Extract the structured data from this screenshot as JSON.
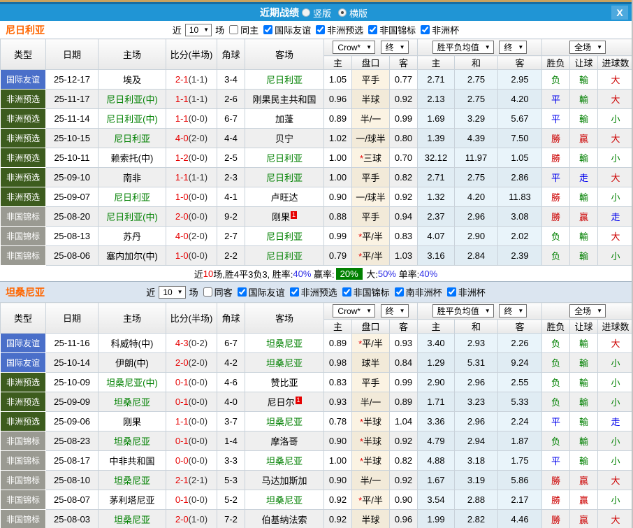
{
  "titlebar": {
    "title": "近期战绩",
    "radios": [
      {
        "label": "竖版",
        "checked": false
      },
      {
        "label": "横版",
        "checked": true
      }
    ],
    "close_label": "X"
  },
  "table_header": {
    "cols": [
      "类型",
      "日期",
      "主场",
      "比分(半场)",
      "角球",
      "客场"
    ],
    "dropdown_odds": "Crow*",
    "dropdown_odds_final": "终",
    "dropdown_avg": "胜平负均值",
    "dropdown_avg_final": "终",
    "dropdown_fullmatch": "全场",
    "sub": [
      "主",
      "盘口",
      "客",
      "主",
      "和",
      "客",
      "胜负",
      "让球",
      "进球数"
    ]
  },
  "type_colors": {
    "国际友谊": "#4a6fc9",
    "非洲预选": "#3d5c1e",
    "非国锦标": "#9a9a92"
  },
  "value_colors": {
    "勝": "#cc0000",
    "贏": "#cc0000",
    "大": "#cc0000",
    "平": "#0000ee",
    "走": "#0000ee",
    "负": "#008000",
    "輸": "#008000",
    "小": "#008000"
  },
  "sections": [
    {
      "team": "尼日利亚",
      "filter": {
        "near_label": "近",
        "count": "10",
        "games_label": "场",
        "same_label": "同主",
        "same_checked": false,
        "competitions": [
          "国际友谊",
          "非洲预选",
          "非国锦标",
          "非洲杯"
        ]
      },
      "rows": [
        {
          "type": "国际友谊",
          "date": "25-12-17",
          "home": "埃及",
          "ft": "2-1",
          "ht": "(1-1)",
          "corners": "3-4",
          "away": "尼日利亚",
          "team_side": "away",
          "oh": "1.05",
          "hc": "平手",
          "oa": "0.77",
          "ah": "2.71",
          "ad": "2.75",
          "aa": "2.95",
          "res": "负",
          "let": "輸",
          "goal": "大"
        },
        {
          "type": "非洲预选",
          "date": "25-11-17",
          "home": "尼日利亚(中)",
          "ft": "1-1",
          "ht": "(1-1)",
          "corners": "2-6",
          "away": "刚果民主共和国",
          "team_side": "home",
          "oh": "0.96",
          "hc": "半球",
          "oa": "0.92",
          "ah": "2.13",
          "ad": "2.75",
          "aa": "4.20",
          "res": "平",
          "let": "輸",
          "goal": "大"
        },
        {
          "type": "非洲预选",
          "date": "25-11-14",
          "home": "尼日利亚(中)",
          "ft": "1-1",
          "ht": "(0-0)",
          "corners": "6-7",
          "away": "加蓬",
          "team_side": "home",
          "oh": "0.89",
          "hc": "半/一",
          "oa": "0.99",
          "ah": "1.69",
          "ad": "3.29",
          "aa": "5.67",
          "res": "平",
          "let": "輸",
          "goal": "小"
        },
        {
          "type": "非洲预选",
          "date": "25-10-15",
          "home": "尼日利亚",
          "ft": "4-0",
          "ht": "(2-0)",
          "corners": "4-4",
          "away": "贝宁",
          "team_side": "home",
          "oh": "1.02",
          "hc": "一/球半",
          "oa": "0.80",
          "ah": "1.39",
          "ad": "4.39",
          "aa": "7.50",
          "res": "勝",
          "let": "贏",
          "goal": "大"
        },
        {
          "type": "非洲预选",
          "date": "25-10-11",
          "home": "赖索托(中)",
          "ft": "1-2",
          "ht": "(0-0)",
          "corners": "2-5",
          "away": "尼日利亚",
          "team_side": "away",
          "oh": "1.00",
          "hc": "三球",
          "star": true,
          "oa": "0.70",
          "ah": "32.12",
          "ad": "11.97",
          "aa": "1.05",
          "res": "勝",
          "let": "輸",
          "goal": "小"
        },
        {
          "type": "非洲预选",
          "date": "25-09-10",
          "home": "南非",
          "ft": "1-1",
          "ht": "(1-1)",
          "corners": "2-3",
          "away": "尼日利亚",
          "team_side": "away",
          "oh": "1.00",
          "hc": "平手",
          "oa": "0.82",
          "ah": "2.71",
          "ad": "2.75",
          "aa": "2.86",
          "res": "平",
          "let": "走",
          "goal": "大"
        },
        {
          "type": "非洲预选",
          "date": "25-09-07",
          "home": "尼日利亚",
          "ft": "1-0",
          "ht": "(0-0)",
          "corners": "4-1",
          "away": "卢旺达",
          "team_side": "home",
          "oh": "0.90",
          "hc": "一/球半",
          "oa": "0.92",
          "ah": "1.32",
          "ad": "4.20",
          "aa": "11.83",
          "res": "勝",
          "let": "輸",
          "goal": "小"
        },
        {
          "type": "非国锦标",
          "date": "25-08-20",
          "home": "尼日利亚(中)",
          "ft": "2-0",
          "ht": "(0-0)",
          "corners": "9-2",
          "away": "刚果",
          "team_side": "home",
          "card": "away",
          "oh": "0.88",
          "hc": "平手",
          "oa": "0.94",
          "ah": "2.37",
          "ad": "2.96",
          "aa": "3.08",
          "res": "勝",
          "let": "贏",
          "goal": "走"
        },
        {
          "type": "非国锦标",
          "date": "25-08-13",
          "home": "苏丹",
          "ft": "4-0",
          "ht": "(2-0)",
          "corners": "2-7",
          "away": "尼日利亚",
          "team_side": "away",
          "oh": "0.99",
          "hc": "平/半",
          "star": true,
          "oa": "0.83",
          "ah": "4.07",
          "ad": "2.90",
          "aa": "2.02",
          "res": "负",
          "let": "輸",
          "goal": "大"
        },
        {
          "type": "非国锦标",
          "date": "25-08-06",
          "home": "塞内加尔(中)",
          "ft": "1-0",
          "ht": "(0-0)",
          "corners": "2-2",
          "away": "尼日利亚",
          "team_side": "away",
          "oh": "0.79",
          "hc": "平/半",
          "star": true,
          "oa": "1.03",
          "ah": "3.16",
          "ad": "2.84",
          "aa": "2.39",
          "res": "负",
          "let": "輸",
          "goal": "小"
        }
      ],
      "summary_parts": [
        {
          "t": "近",
          "c": "#000000"
        },
        {
          "t": "10",
          "c": "#e60000"
        },
        {
          "t": "场,胜4平3负3, 胜率:",
          "c": "#000000"
        },
        {
          "t": "40%",
          "c": "#2a2ae6"
        },
        {
          "t": " 赢率:",
          "c": "#000000"
        },
        {
          "t": "20%",
          "c": "#ffffff",
          "bg": "#008000"
        },
        {
          "t": " 大:",
          "c": "#000000"
        },
        {
          "t": "50%",
          "c": "#2a2ae6"
        },
        {
          "t": " 单率:",
          "c": "#000000"
        },
        {
          "t": "40%",
          "c": "#2a2ae6"
        }
      ]
    },
    {
      "team": "坦桑尼亚",
      "filter": {
        "near_label": "近",
        "count": "10",
        "games_label": "场",
        "same_label": "同客",
        "same_checked": false,
        "competitions": [
          "国际友谊",
          "非洲预选",
          "非国锦标",
          "南非洲杯",
          "非洲杯"
        ]
      },
      "rows": [
        {
          "type": "国际友谊",
          "date": "25-11-16",
          "home": "科威特(中)",
          "ft": "4-3",
          "ht": "(0-2)",
          "corners": "6-7",
          "away": "坦桑尼亚",
          "team_side": "away",
          "oh": "0.89",
          "hc": "平/半",
          "star": true,
          "oa": "0.93",
          "ah": "3.40",
          "ad": "2.93",
          "aa": "2.26",
          "res": "负",
          "let": "輸",
          "goal": "大"
        },
        {
          "type": "国际友谊",
          "date": "25-10-14",
          "home": "伊朗(中)",
          "ft": "2-0",
          "ht": "(2-0)",
          "corners": "4-2",
          "away": "坦桑尼亚",
          "team_side": "away",
          "oh": "0.98",
          "hc": "球半",
          "oa": "0.84",
          "ah": "1.29",
          "ad": "5.31",
          "aa": "9.24",
          "res": "负",
          "let": "輸",
          "goal": "小"
        },
        {
          "type": "非洲预选",
          "date": "25-10-09",
          "home": "坦桑尼亚(中)",
          "ft": "0-1",
          "ht": "(0-0)",
          "corners": "4-6",
          "away": "赞比亚",
          "team_side": "home",
          "oh": "0.83",
          "hc": "平手",
          "oa": "0.99",
          "ah": "2.90",
          "ad": "2.96",
          "aa": "2.55",
          "res": "负",
          "let": "輸",
          "goal": "小"
        },
        {
          "type": "非洲预选",
          "date": "25-09-09",
          "home": "坦桑尼亚",
          "ft": "0-1",
          "ht": "(0-0)",
          "corners": "4-0",
          "away": "尼日尔",
          "team_side": "home",
          "card": "away",
          "oh": "0.93",
          "hc": "半/一",
          "oa": "0.89",
          "ah": "1.71",
          "ad": "3.23",
          "aa": "5.33",
          "res": "负",
          "let": "輸",
          "goal": "小"
        },
        {
          "type": "非洲预选",
          "date": "25-09-06",
          "home": "刚果",
          "ft": "1-1",
          "ht": "(0-0)",
          "corners": "3-7",
          "away": "坦桑尼亚",
          "team_side": "away",
          "oh": "0.78",
          "hc": "半球",
          "star": true,
          "oa": "1.04",
          "ah": "3.36",
          "ad": "2.96",
          "aa": "2.24",
          "res": "平",
          "let": "輸",
          "goal": "走"
        },
        {
          "type": "非国锦标",
          "date": "25-08-23",
          "home": "坦桑尼亚",
          "ft": "0-1",
          "ht": "(0-0)",
          "corners": "1-4",
          "away": "摩洛哥",
          "team_side": "home",
          "oh": "0.90",
          "hc": "半球",
          "star": true,
          "oa": "0.92",
          "ah": "4.79",
          "ad": "2.94",
          "aa": "1.87",
          "res": "负",
          "let": "輸",
          "goal": "小"
        },
        {
          "type": "非国锦标",
          "date": "25-08-17",
          "home": "中非共和国",
          "ft": "0-0",
          "ht": "(0-0)",
          "corners": "3-3",
          "away": "坦桑尼亚",
          "team_side": "away",
          "oh": "1.00",
          "hc": "半球",
          "star": true,
          "oa": "0.82",
          "ah": "4.88",
          "ad": "3.18",
          "aa": "1.75",
          "res": "平",
          "let": "輸",
          "goal": "小"
        },
        {
          "type": "非国锦标",
          "date": "25-08-10",
          "home": "坦桑尼亚",
          "ft": "2-1",
          "ht": "(2-1)",
          "corners": "5-3",
          "away": "马达加斯加",
          "team_side": "home",
          "oh": "0.90",
          "hc": "半/一",
          "oa": "0.92",
          "ah": "1.67",
          "ad": "3.19",
          "aa": "5.86",
          "res": "勝",
          "let": "贏",
          "goal": "大"
        },
        {
          "type": "非国锦标",
          "date": "25-08-07",
          "home": "茅利塔尼亚",
          "ft": "0-1",
          "ht": "(0-0)",
          "corners": "5-2",
          "away": "坦桑尼亚",
          "team_side": "away",
          "oh": "0.92",
          "hc": "平/半",
          "star": true,
          "oa": "0.90",
          "ah": "3.54",
          "ad": "2.88",
          "aa": "2.17",
          "res": "勝",
          "let": "贏",
          "goal": "小"
        },
        {
          "type": "非国锦标",
          "date": "25-08-03",
          "home": "坦桑尼亚",
          "ft": "2-0",
          "ht": "(1-0)",
          "corners": "7-2",
          "away": "伯基纳法索",
          "team_side": "home",
          "oh": "0.92",
          "hc": "半球",
          "oa": "0.96",
          "ah": "1.99",
          "ad": "2.82",
          "aa": "4.46",
          "res": "勝",
          "let": "贏",
          "goal": "大"
        }
      ]
    }
  ]
}
